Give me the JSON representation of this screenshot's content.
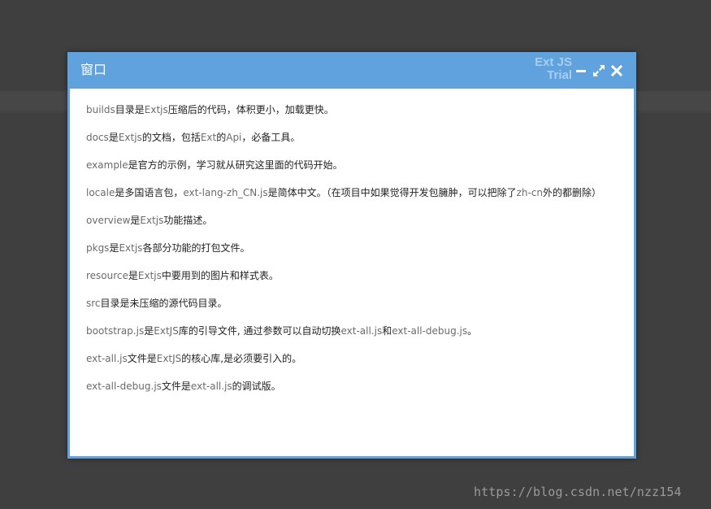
{
  "window": {
    "title": "窗口",
    "trial_badge": [
      "Ext JS",
      "Trial"
    ],
    "tools": [
      "minimize-icon",
      "maximize-icon",
      "close-icon"
    ],
    "accent_color": "#5fa2dd"
  },
  "paragraphs": [
    [
      {
        "t": "builds",
        "tech": true
      },
      {
        "t": "目录是",
        "tech": false
      },
      {
        "t": "Extjs",
        "tech": true
      },
      {
        "t": "压缩后的代码，体积更小，加载更快。",
        "tech": false
      }
    ],
    [
      {
        "t": "docs",
        "tech": true
      },
      {
        "t": "是",
        "tech": false
      },
      {
        "t": "Extjs",
        "tech": true
      },
      {
        "t": "的文档，包括",
        "tech": false
      },
      {
        "t": "Ext",
        "tech": true
      },
      {
        "t": "的",
        "tech": false
      },
      {
        "t": "Api",
        "tech": true
      },
      {
        "t": "，必备工具。",
        "tech": false
      }
    ],
    [
      {
        "t": "example",
        "tech": true
      },
      {
        "t": "是官方的示例，学习就从研究这里面的代码开始。",
        "tech": false
      }
    ],
    [
      {
        "t": "locale",
        "tech": true
      },
      {
        "t": "是多国语言包，",
        "tech": false
      },
      {
        "t": "ext-lang-zh_CN.js",
        "tech": true
      },
      {
        "t": "是简体中文。（在项目中如果觉得开发包臃肿，可以把除了",
        "tech": false
      },
      {
        "t": "zh-cn",
        "tech": true
      },
      {
        "t": "外的都删除）",
        "tech": false
      }
    ],
    [
      {
        "t": "overview",
        "tech": true
      },
      {
        "t": "是",
        "tech": false
      },
      {
        "t": "Extjs",
        "tech": true
      },
      {
        "t": "功能描述。",
        "tech": false
      }
    ],
    [
      {
        "t": "pkgs",
        "tech": true
      },
      {
        "t": "是",
        "tech": false
      },
      {
        "t": "Extjs",
        "tech": true
      },
      {
        "t": "各部分功能的打包文件。",
        "tech": false
      }
    ],
    [
      {
        "t": "resource",
        "tech": true
      },
      {
        "t": "是",
        "tech": false
      },
      {
        "t": "Extjs",
        "tech": true
      },
      {
        "t": "中要用到的图片和样式表。",
        "tech": false
      }
    ],
    [
      {
        "t": "src",
        "tech": true
      },
      {
        "t": "目录是未压缩的源代码目录。",
        "tech": false
      }
    ],
    [
      {
        "t": "bootstrap.js",
        "tech": true
      },
      {
        "t": "是",
        "tech": false
      },
      {
        "t": "ExtJS",
        "tech": true
      },
      {
        "t": "库的引导文件, 通过参数可以自动切换",
        "tech": false
      },
      {
        "t": "ext-all.js",
        "tech": true
      },
      {
        "t": "和",
        "tech": false
      },
      {
        "t": "ext-all-debug.js",
        "tech": true
      },
      {
        "t": "。",
        "tech": false
      }
    ],
    [
      {
        "t": "ext-all.js",
        "tech": true
      },
      {
        "t": "文件是",
        "tech": false
      },
      {
        "t": "ExtJS",
        "tech": true
      },
      {
        "t": "的核心库,是必须要引入的。",
        "tech": false
      }
    ],
    [
      {
        "t": "ext-all-debug.js",
        "tech": true
      },
      {
        "t": "文件是",
        "tech": false
      },
      {
        "t": "ext-all.js",
        "tech": true
      },
      {
        "t": "的调试版。",
        "tech": false
      }
    ]
  ],
  "watermark": "https://blog.csdn.net/nzz154"
}
